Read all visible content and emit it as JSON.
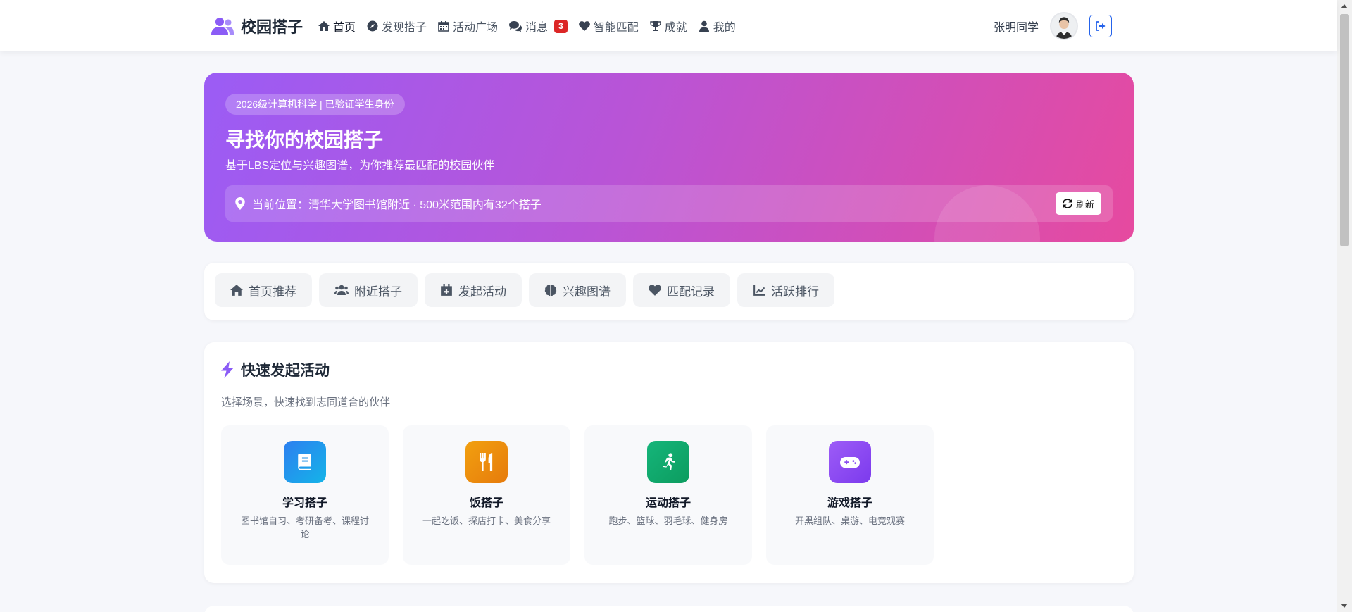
{
  "brand": {
    "name": "校园搭子"
  },
  "nav": [
    {
      "label": "首页",
      "icon": "home-icon",
      "active": true
    },
    {
      "label": "发现搭子",
      "icon": "compass-icon"
    },
    {
      "label": "活动广场",
      "icon": "calendar-icon"
    },
    {
      "label": "消息",
      "icon": "chat-icon",
      "badge": "3"
    },
    {
      "label": "智能匹配",
      "icon": "heart-icon"
    },
    {
      "label": "成就",
      "icon": "trophy-icon"
    },
    {
      "label": "我的",
      "icon": "user-icon"
    }
  ],
  "user": {
    "name": "张明同学"
  },
  "hero": {
    "tag": "2026级计算机科学 | 已验证学生身份",
    "title": "寻找你的校园搭子",
    "subtitle": "基于LBS定位与兴趣图谱，为你推荐最匹配的校园伙伴",
    "location": "当前位置：清华大学图书馆附近 · 500米范围内有32个搭子",
    "refresh_label": "刷新"
  },
  "tabs": [
    {
      "label": "首页推荐",
      "icon": "home-icon"
    },
    {
      "label": "附近搭子",
      "icon": "users-icon"
    },
    {
      "label": "发起活动",
      "icon": "calendar-plus-icon"
    },
    {
      "label": "兴趣图谱",
      "icon": "brain-icon"
    },
    {
      "label": "匹配记录",
      "icon": "heart-icon"
    },
    {
      "label": "活跃排行",
      "icon": "chart-line-icon"
    }
  ],
  "quick": {
    "title": "快速发起活动",
    "subtitle": "选择场景，快速找到志同道合的伙伴",
    "scenes": [
      {
        "name": "学习搭子",
        "desc": "图书馆自习、考研备考、课程讨论",
        "icon": "book-icon",
        "color": "#1e8fe6"
      },
      {
        "name": "饭搭子",
        "desc": "一起吃饭、探店打卡、美食分享",
        "icon": "utensils-icon",
        "color": "#ec8a0e"
      },
      {
        "name": "运动搭子",
        "desc": "跑步、篮球、羽毛球、健身房",
        "icon": "running-icon",
        "color": "#10a86c"
      },
      {
        "name": "游戏搭子",
        "desc": "开黑组队、桌游、电竞观赛",
        "icon": "gamepad-icon",
        "color": "#8b4df0"
      }
    ]
  }
}
